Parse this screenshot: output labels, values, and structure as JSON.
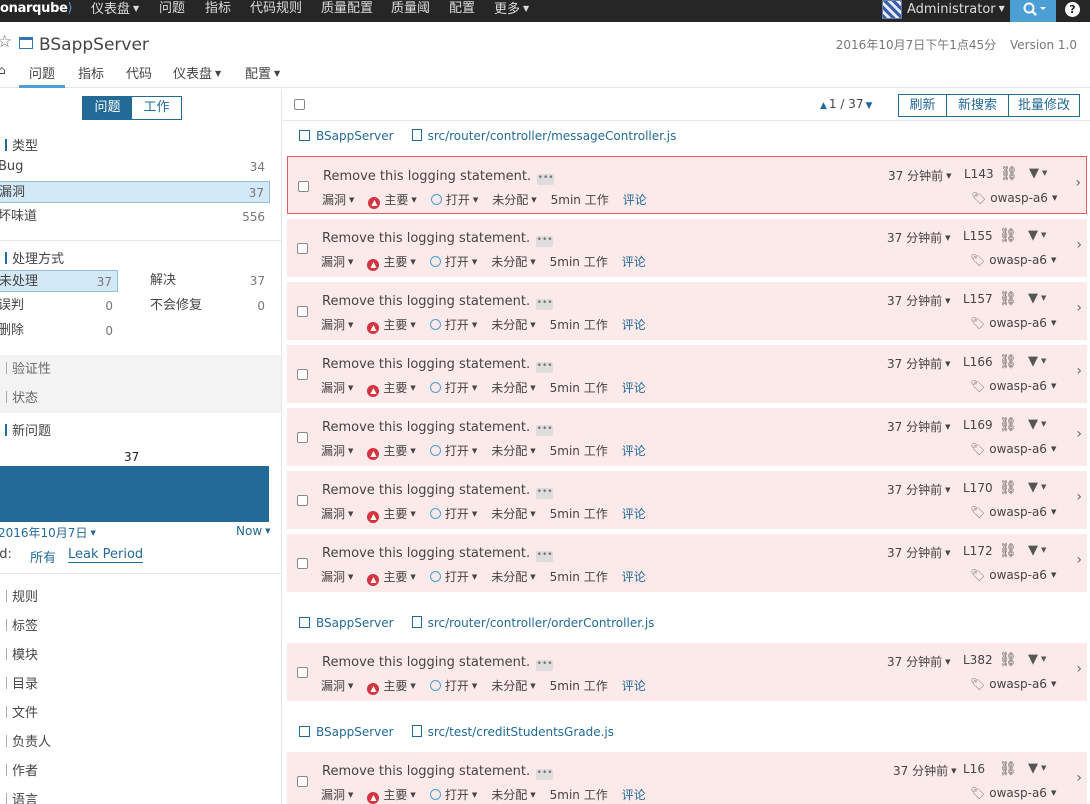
{
  "topnav": {
    "logo": "onarqube",
    "items": [
      "仪表盘",
      "问题",
      "指标",
      "代码规则",
      "质量配置",
      "质量阈",
      "配置",
      "更多"
    ],
    "user": "Administrator"
  },
  "header": {
    "project": "BSappServer",
    "date": "2016年10月7日下午1点45分",
    "version": "Version 1.0",
    "tabs": [
      "问题",
      "指标",
      "代码",
      "仪表盘",
      "配置"
    ]
  },
  "sidebar": {
    "mode": {
      "issues": "问题",
      "effort": "工作"
    },
    "type_title": "类型",
    "types": [
      {
        "label": "Bug",
        "count": "34"
      },
      {
        "label": "漏洞",
        "count": "37"
      },
      {
        "label": "坏味道",
        "count": "556"
      }
    ],
    "resolution_title": "处理方式",
    "resolutions": [
      {
        "label": "未处理",
        "count": "37"
      },
      {
        "label": "解决",
        "count": "37"
      },
      {
        "label": "误判",
        "count": "0"
      },
      {
        "label": "不会修复",
        "count": "0"
      },
      {
        "label": "删除",
        "count": "0"
      }
    ],
    "severity_title": "验证性",
    "status_title": "状态",
    "new_title": "新问题",
    "new_count": "37",
    "period_from": "2016年10月7日",
    "period_to": "Now",
    "period_label": "Period:",
    "period_all": "所有",
    "period_leak": "Leak Period",
    "more_facets": [
      "规则",
      "标签",
      "模块",
      "目录",
      "文件",
      "负责人",
      "作者",
      "语言"
    ]
  },
  "toolbar": {
    "pager": "1 / 37",
    "refresh": "刷新",
    "new_search": "新搜索",
    "bulk_change": "批量修改"
  },
  "groups": [
    {
      "project": "BSappServer",
      "path": "src/router/controller/messageController.js"
    },
    {
      "project": "BSappServer",
      "path": "src/router/controller/orderController.js"
    },
    {
      "project": "BSappServer",
      "path": "src/test/creditStudentsGrade.js"
    }
  ],
  "issue_common": {
    "message": "Remove this logging statement.",
    "type": "漏洞",
    "severity": "主要",
    "status": "打开",
    "assignee": "未分配",
    "effort": "5min 工作",
    "comment": "评论",
    "age": "37 分钟前",
    "tag": "owasp-a6"
  },
  "issues": [
    {
      "line": "L143"
    },
    {
      "line": "L155"
    },
    {
      "line": "L157"
    },
    {
      "line": "L166"
    },
    {
      "line": "L169"
    },
    {
      "line": "L170"
    },
    {
      "line": "L172"
    },
    {
      "line": "L382"
    },
    {
      "line": "L16"
    }
  ],
  "colors": {
    "accent": "#236a97",
    "issue_bg": "#fce9e9",
    "selected_border": "#e06060",
    "navbar": "#262626"
  }
}
